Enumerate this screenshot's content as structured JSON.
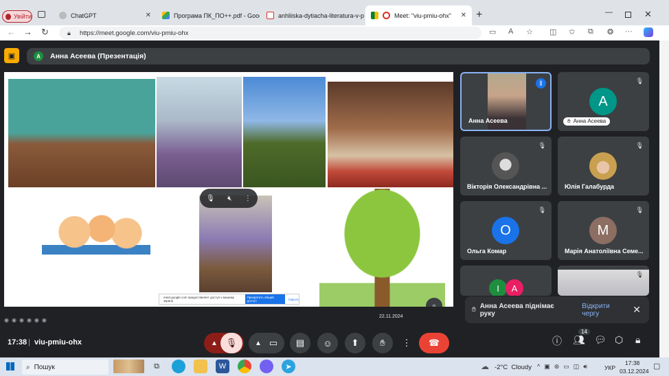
{
  "browser": {
    "profile_label": "Увійти",
    "tabs": [
      {
        "title": "ChatGPT",
        "icon": "chatgpt-icon"
      },
      {
        "title": "Програма ПК_ПО++.pdf - Goog",
        "icon": "google-drive-icon"
      },
      {
        "title": "anhliiska-dytiacha-literatura-v-po",
        "icon": "pdf-icon"
      },
      {
        "title": "Meet: \"viu-pmiu-ohx\"",
        "icon": "meet-icon"
      }
    ],
    "url": "https://meet.google.com/viu-pmiu-ohx"
  },
  "meet": {
    "presenter_label": "Анна Асеева (Презентація)",
    "presenter_initial": "А",
    "slide_date": "22.11.2024",
    "popup_text": "meet.google.com предоставляет доступ к вашему экрану.",
    "popup_button": "Прекратить общий доступ",
    "popup_link": "Скрыть",
    "participants": [
      {
        "name": "Анна Асеева",
        "speaking": true
      },
      {
        "name": "Анна Асеева",
        "initial": "А",
        "color": "#009688"
      },
      {
        "name": "Вікторія Олександрівна ..."
      },
      {
        "name": "Юлія Галабурда"
      },
      {
        "name": "Ольга Комар",
        "initial": "О",
        "color": "#1a73e8"
      },
      {
        "name": "Марія Анатоліївна Семе...",
        "initial": "М",
        "color": "#8d6e63"
      },
      {
        "name": "",
        "initial": "І",
        "color": "#1e8e3e",
        "initial2": "А",
        "color2": "#e91e63"
      },
      {
        "name": ""
      }
    ],
    "hand_notification": "Анна Асеева піднімає руку",
    "open_queue": "Відкрити чергу"
  },
  "controls": {
    "time": "17:38",
    "meeting_code": "viu-pmiu-ohx",
    "people_count": "14"
  },
  "taskbar": {
    "search_placeholder": "Пошук",
    "weather": "-2°C  Cloudy",
    "lang": "УКР",
    "clock_time": "17:38",
    "clock_date": "03.12.2024"
  }
}
